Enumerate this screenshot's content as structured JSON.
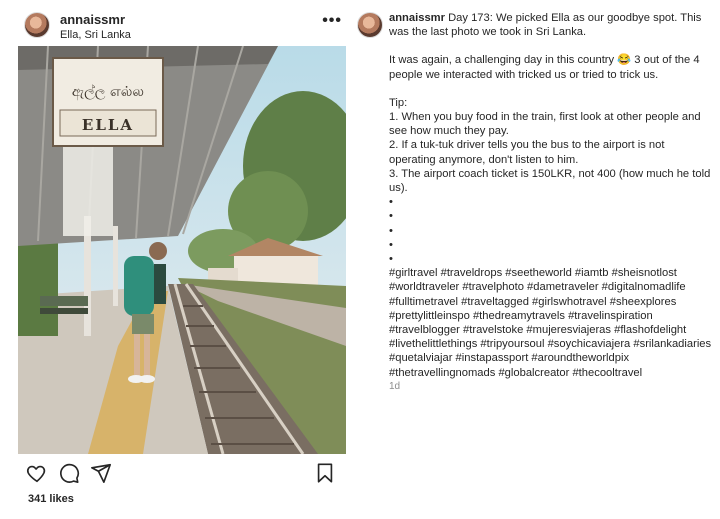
{
  "post": {
    "username": "annaissmr",
    "location": "Ella, Sri Lanka",
    "more_label": "•••",
    "likes": "341 likes",
    "sign_text_top": "ඇල්ල எல்ல",
    "sign_text_bottom": "ELLA"
  },
  "caption": {
    "username": "annaissmr",
    "intro": "Day 173: We picked Ella as our goodbye spot. This was the last photo we took in Sri Lanka.",
    "paragraph2": "It was again, a challenging day in this country 😂 3 out of the 4 people we interacted with tricked us or tried to trick us.",
    "tip_title": "Tip:",
    "tips": [
      " 1. When you buy food in the train, first look at other people and see how much they pay.",
      " 2. If a tuk-tuk driver tells you the bus to the airport is not operating anymore, don't listen to him.",
      " 3. The airport coach ticket is 150LKR, not 400 (how much he told us)."
    ],
    "bullets": [
      "•",
      "•",
      "•",
      "•",
      "•"
    ],
    "hashtags": "#girltravel #traveldrops #seetheworld #iamtb #sheisnotlost #worldtraveler #travelphoto #dametraveler #digitalnomadlife #fulltimetravel #traveltagged #girlswhotravel #sheexplores #prettylittleinspo #thedreamytravels #travelinspiration #travelblogger #travelstoke #mujeresviajeras #flashofdelight #livethelittlethings #tripyoursoul #soychicaviajera #srilankadiaries #quetalviajar #instapassport #aroundtheworldpix #thetravellingnomads #globalcreator #thecooltravel",
    "time": "1d"
  },
  "icons": [
    "heart-icon",
    "comment-icon",
    "share-icon",
    "bookmark-icon"
  ],
  "colors": {
    "text": "#262626",
    "muted": "#8e8e8e",
    "background": "#ffffff"
  }
}
